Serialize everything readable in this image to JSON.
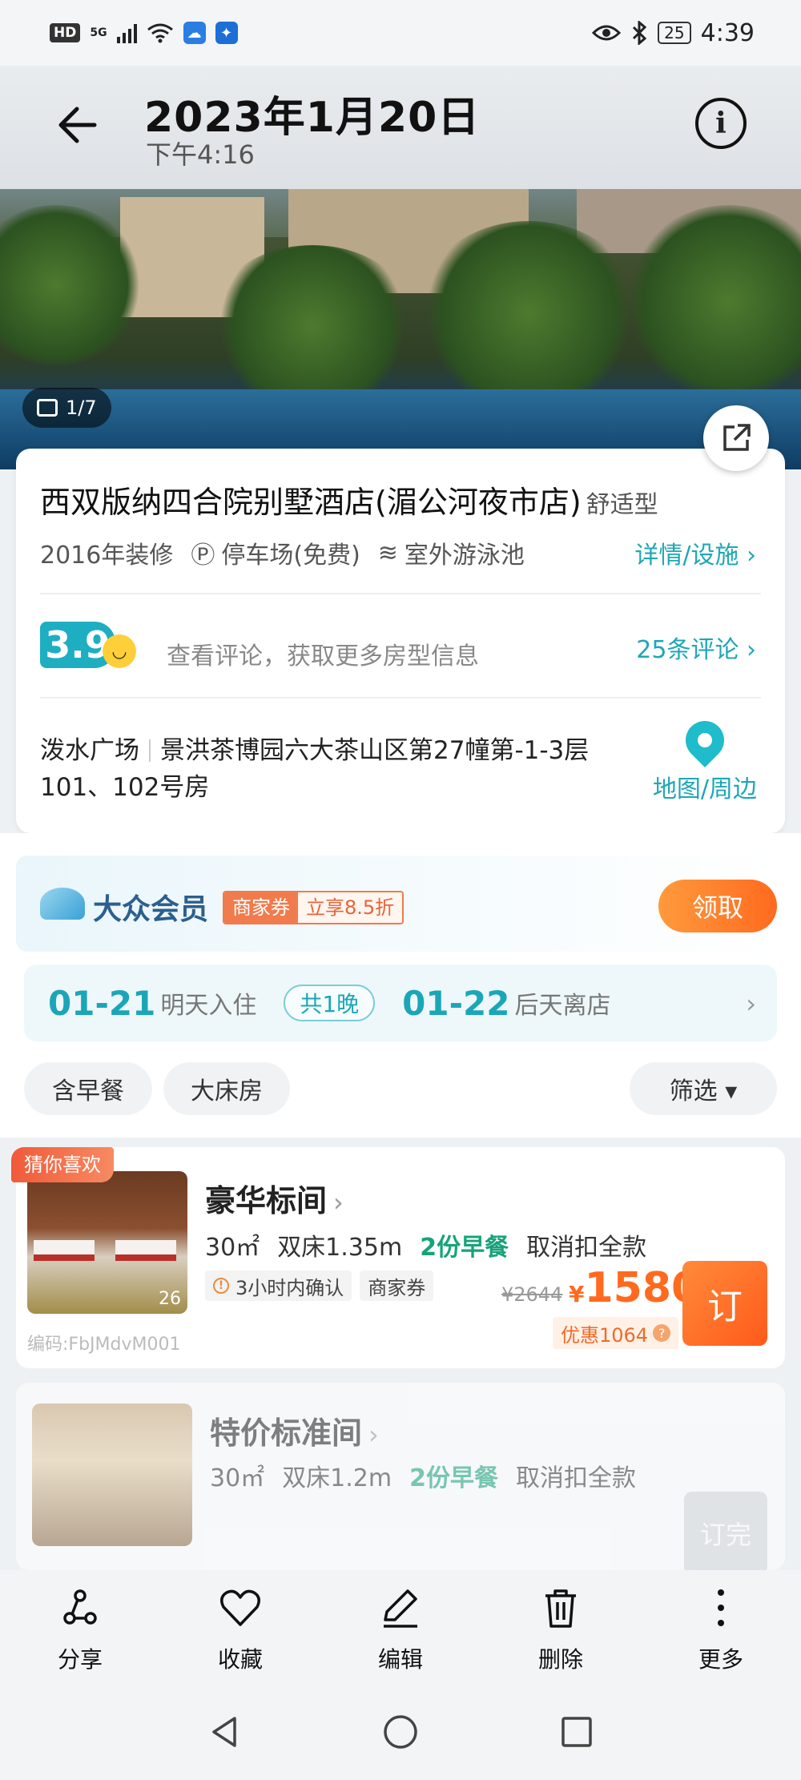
{
  "status_bar": {
    "hd": "HD",
    "signal": "5G",
    "battery": "25",
    "time": "4:39"
  },
  "header": {
    "title": "2023年1月20日",
    "subtitle": "下午4:16"
  },
  "hero": {
    "photo_index": "1/7"
  },
  "hotel": {
    "name": "西双版纳四合院别墅酒店(湄公河夜市店)",
    "type": "舒适型",
    "renovated": "2016年装修",
    "parking": "停车场(免费)",
    "pool": "室外游泳池",
    "detail_link": "详情/设施 ›",
    "score": "3.9",
    "review_hint": "查看评论，获取更多房型信息",
    "review_link": "25条评论 ›",
    "area": "泼水广场",
    "address": "景洪茶博园六大茶山区第27幢第-1-3层101、102号房",
    "map_link": "地图/周边"
  },
  "member": {
    "title": "大众会员",
    "coupon_a": "商家券",
    "coupon_b": "立享8.5折",
    "claim": "领取"
  },
  "dates": {
    "checkin_date": "01-21",
    "checkin_label": "明天入住",
    "nights": "共1晚",
    "checkout_date": "01-22",
    "checkout_label": "后天离店",
    "chevron": "›"
  },
  "filters": {
    "breakfast": "含早餐",
    "bigbed": "大床房",
    "filter": "筛选 ▾"
  },
  "rooms": [
    {
      "tag": "猜你喜欢",
      "name": "豪华标间",
      "chev": "›",
      "photo_count": "26",
      "area": "30㎡",
      "bed": "双床1.35m",
      "breakfast": "2份早餐",
      "cancel": "取消扣全款",
      "tag1": "3小时内确认",
      "tag2": "商家券",
      "code": "编码:FbJMdvM001",
      "orig_price": "¥2644",
      "currency": "¥",
      "price": "1580",
      "discount": "优惠1064",
      "book": "订"
    },
    {
      "name": "特价标准间",
      "chev": "›",
      "area": "30㎡",
      "bed": "双床1.2m",
      "breakfast": "2份早餐",
      "cancel": "取消扣全款",
      "book": "订完"
    }
  ],
  "toolbar": {
    "share": "分享",
    "favorite": "收藏",
    "edit": "编辑",
    "delete": "删除",
    "more": "更多"
  },
  "colors": {
    "accent": "#1fa7b5",
    "orange": "#ff6a1f",
    "green": "#17a37a"
  }
}
